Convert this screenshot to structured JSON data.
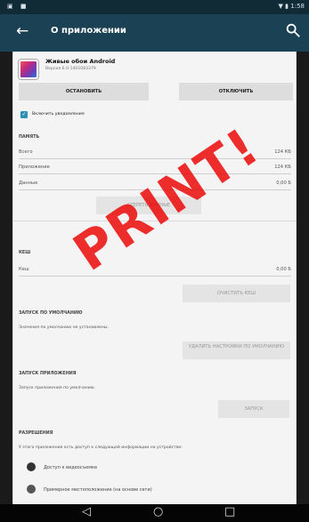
{
  "status_bar": {
    "time": "1:58"
  },
  "app_bar": {
    "title": "О приложении"
  },
  "app": {
    "name": "Живые обои Android",
    "version": "Версия 6.0-1401083379"
  },
  "buttons": {
    "stop": "ОСТАНОВИТЬ",
    "disable": "ОТКЛЮЧИТЬ"
  },
  "notifications": {
    "checkbox_label": "Включить уведомления"
  },
  "memory": {
    "section": "ПАМЯТЬ",
    "rows": [
      {
        "label": "Всего",
        "value": "124 КБ"
      },
      {
        "label": "Приложение",
        "value": "124 КБ"
      },
      {
        "label": "Данные",
        "value": "0,00 Б"
      }
    ],
    "clear_button": "СТЕРЕТЬ ДАННЫЕ"
  },
  "cache": {
    "section": "КЕШ",
    "row": {
      "label": "Кеш",
      "value": "0,00 Б"
    },
    "clear_button": "ОЧИСТИТЬ КЕШ"
  },
  "default_launch": {
    "section": "ЗАПУСК ПО УМОЛЧАНИЮ",
    "description": "Значения по умолчанию не установлены.",
    "button": "УДАЛИТЬ НАСТРОЙКИ ПО УМОЛЧАНИЮ"
  },
  "app_launch": {
    "section": "ЗАПУСК ПРИЛОЖЕНИЯ",
    "description": "Запуск приложения по умолчанию.",
    "button": "ЗАПУСК"
  },
  "permissions": {
    "section": "РАЗРЕШЕНИЯ",
    "description": "У этого приложения есть доступ к следующей информации на устройстве:",
    "items": [
      "Доступ к видеосъемке",
      "Примерное местоположение (на основе сети)"
    ]
  },
  "watermark": "PRINT!"
}
